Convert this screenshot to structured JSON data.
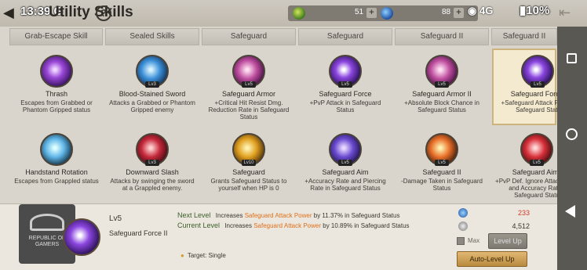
{
  "status": {
    "time": "13:39",
    "carrier_letter": "G",
    "signal": "4G",
    "battery": "10%"
  },
  "header": {
    "title": "Utility Skills",
    "help_symbol": "?",
    "currency_1_value": "51",
    "currency_2_value": "88",
    "plus_symbol": "+"
  },
  "categories": [
    {
      "label": "Grab-Escape Skill"
    },
    {
      "label": "Sealed Skills"
    },
    {
      "label": "Safeguard"
    },
    {
      "label": "Safeguard"
    },
    {
      "label": "Safeguard II"
    },
    {
      "label": "Safeguard II"
    }
  ],
  "skills": [
    {
      "name": "Thrash",
      "level": "",
      "desc": "Escapes from Grabbed or Phantom Gripped status",
      "icon": "ico-purple"
    },
    {
      "name": "Blood-Stained Sword",
      "level": "Lv3",
      "desc": "Attacks a Grabbed or Phantom Gripped enemy",
      "icon": "ico-blue"
    },
    {
      "name": "Safeguard Armor",
      "level": "Lv5",
      "desc": "+Critical Hit Resist Dmg. Reduction Rate in Safeguard Status",
      "icon": "ico-pink"
    },
    {
      "name": "Safeguard Force",
      "level": "Lv5",
      "desc": "+PvP Attack in Safeguard Status",
      "icon": "ico-xpurple"
    },
    {
      "name": "Safeguard Armor II",
      "level": "Lv5",
      "desc": "+Absolute Block Chance in Safeguard Status",
      "icon": "ico-pink"
    },
    {
      "name": "Safeguard Force II",
      "level": "Lv5",
      "desc": "+Safeguard Attack Power in Safeguard Status",
      "icon": "ico-xpurple"
    },
    {
      "name": "Handstand Rotation",
      "level": "",
      "desc": "Escapes from Grappled status",
      "icon": "ico-cyan"
    },
    {
      "name": "Downward Slash",
      "level": "Lv3",
      "desc": "Attacks by swinging the sword at a Grappled enemy.",
      "icon": "ico-red"
    },
    {
      "name": "Safeguard",
      "level": "Lv10",
      "desc": "Grants Safeguard Status to yourself when HP is 0",
      "icon": "ico-gold"
    },
    {
      "name": "Safeguard Aim",
      "level": "Lv5",
      "desc": "+Accuracy Rate and Piercing Rate in Safeguard Status",
      "icon": "ico-violet"
    },
    {
      "name": "Safeguard II",
      "level": "Lv5",
      "desc": "-Damage Taken in Safeguard Status",
      "icon": "ico-orange"
    },
    {
      "name": "Safeguard Aim II",
      "level": "Lv5",
      "desc": "+PvP Def. Ignore Attack Power and Accuracy Rate in Safeguard Status",
      "icon": "ico-crimson"
    }
  ],
  "selected": {
    "level": "Lv5",
    "name": "Safeguard Force II",
    "next_label": "Next Level",
    "next_pre": "Increases",
    "next_stat": "Safeguard Attack Power",
    "next_post": "by 11.37% in Safeguard Status",
    "current_label": "Current Level",
    "current_pre": "Increases",
    "current_stat": "Safeguard Attack Power",
    "current_post": "by 10.89% in Safeguard Status",
    "target_label": "Target: Single"
  },
  "costs": {
    "cost_1": "233",
    "cost_2": "4,512"
  },
  "buttons": {
    "max_label": "Max",
    "level_up": "Level Up",
    "auto_level_up": "Auto-Level Up"
  },
  "logo": {
    "text": "REPUBLIC OF GAMERS"
  },
  "colors": {
    "accent_orange": "#e0701c",
    "cost_red": "#d23a2a",
    "selected_bg": "#f4ead0"
  }
}
